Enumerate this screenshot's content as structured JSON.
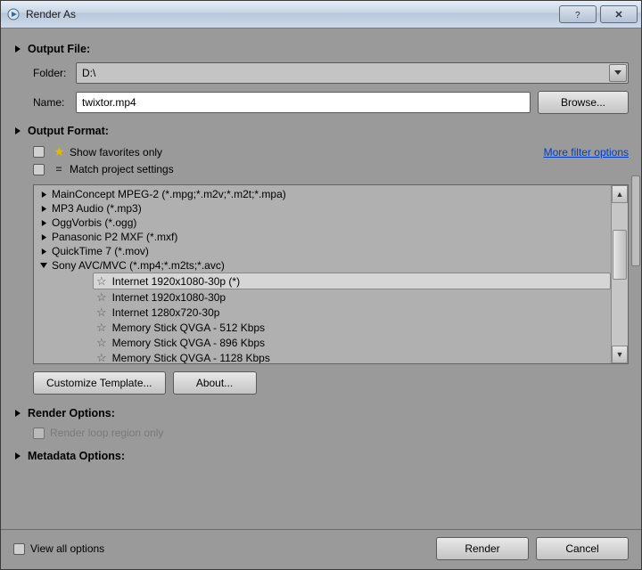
{
  "window": {
    "title": "Render As"
  },
  "sections": {
    "output_file": "Output File:",
    "output_format": "Output Format:",
    "render_options": "Render Options:",
    "metadata_options": "Metadata Options:"
  },
  "output_file": {
    "folder_label": "Folder:",
    "folder_value": "D:\\",
    "name_label": "Name:",
    "name_value": "twixtor.mp4",
    "browse": "Browse..."
  },
  "output_format": {
    "show_favorites": "Show favorites only",
    "match_project": "Match project settings",
    "more_filter_options": "More filter options",
    "customize_template": "Customize Template...",
    "about": "About..."
  },
  "formats": [
    {
      "expanded": false,
      "label": "MainConcept MPEG-2 (*.mpg;*.m2v;*.m2t;*.mpa)"
    },
    {
      "expanded": false,
      "label": "MP3 Audio (*.mp3)"
    },
    {
      "expanded": false,
      "label": "OggVorbis (*.ogg)"
    },
    {
      "expanded": false,
      "label": "Panasonic P2 MXF (*.mxf)"
    },
    {
      "expanded": false,
      "label": "QuickTime 7 (*.mov)"
    },
    {
      "expanded": true,
      "label": "Sony AVC/MVC (*.mp4;*.m2ts;*.avc)"
    }
  ],
  "presets": [
    {
      "label": "Internet 1920x1080-30p (*)",
      "selected": true
    },
    {
      "label": "Internet 1920x1080-30p",
      "selected": false
    },
    {
      "label": "Internet 1280x720-30p",
      "selected": false
    },
    {
      "label": "Memory Stick QVGA - 512 Kbps",
      "selected": false
    },
    {
      "label": "Memory Stick QVGA - 896 Kbps",
      "selected": false
    },
    {
      "label": "Memory Stick QVGA - 1128 Kbps",
      "selected": false
    }
  ],
  "render_options": {
    "loop_region": "Render loop region only"
  },
  "footer": {
    "view_all": "View all options",
    "render": "Render",
    "cancel": "Cancel"
  }
}
